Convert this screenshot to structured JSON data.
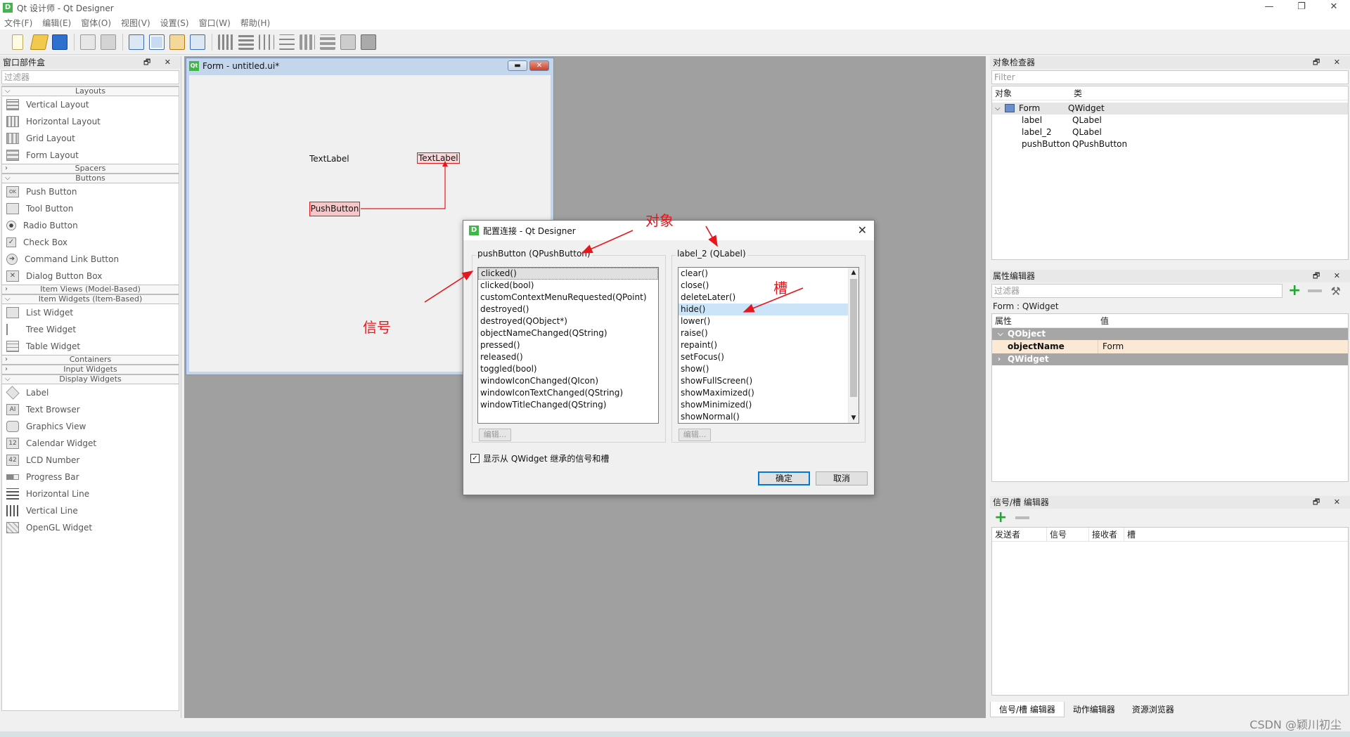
{
  "app": {
    "title": "Qt 设计师 - Qt Designer",
    "logo": "D",
    "window_controls": [
      "—",
      "❐",
      "✕"
    ]
  },
  "menu": [
    "文件(F)",
    "编辑(E)",
    "窗体(O)",
    "视图(V)",
    "设置(S)",
    "窗口(W)",
    "帮助(H)"
  ],
  "widget_box": {
    "title": "窗口部件盒",
    "filter_placeholder": "过滤器",
    "categories": {
      "layouts": "Layouts",
      "spacers": "Spacers",
      "buttons": "Buttons",
      "item_views": "Item Views (Model-Based)",
      "item_widgets": "Item Widgets (Item-Based)",
      "containers": "Containers",
      "input_widgets": "Input Widgets",
      "display_widgets": "Display Widgets"
    },
    "layout_items": [
      "Vertical Layout",
      "Horizontal Layout",
      "Grid Layout",
      "Form Layout"
    ],
    "button_items": [
      "Push Button",
      "Tool Button",
      "Radio Button",
      "Check Box",
      "Command Link Button",
      "Dialog Button Box"
    ],
    "item_widget_items": [
      "List Widget",
      "Tree Widget",
      "Table Widget"
    ],
    "display_items": [
      "Label",
      "Text Browser",
      "Graphics View",
      "Calendar Widget",
      "LCD Number",
      "Progress Bar",
      "Horizontal Line",
      "Vertical Line",
      "OpenGL Widget"
    ]
  },
  "form": {
    "title": "Form - untitled.ui*",
    "qt_badge": "Qt",
    "label1": "TextLabel",
    "label2": "TextLabel",
    "button": "PushButton"
  },
  "dialog": {
    "title": "配置连接 - Qt Designer",
    "close": "✕",
    "sender_title": "pushButton (QPushButton)",
    "receiver_title": "label_2 (QLabel)",
    "signals": [
      "clicked()",
      "clicked(bool)",
      "customContextMenuRequested(QPoint)",
      "destroyed()",
      "destroyed(QObject*)",
      "objectNameChanged(QString)",
      "pressed()",
      "released()",
      "toggled(bool)",
      "windowIconChanged(QIcon)",
      "windowIconTextChanged(QString)",
      "windowTitleChanged(QString)"
    ],
    "slots": [
      "clear()",
      "close()",
      "deleteLater()",
      "hide()",
      "lower()",
      "raise()",
      "repaint()",
      "setFocus()",
      "show()",
      "showFullScreen()",
      "showMaximized()",
      "showMinimized()",
      "showNormal()"
    ],
    "edit_label": "编辑...",
    "inherit_checkbox": "显示从 QWidget 继承的信号和槽",
    "ok": "确定",
    "cancel": "取消"
  },
  "annotations": {
    "object": "对象",
    "signal": "信号",
    "slot": "槽"
  },
  "object_inspector": {
    "title": "对象检查器",
    "filter_placeholder": "Filter",
    "col_object": "对象",
    "col_class": "类",
    "rows": [
      {
        "name": "Form",
        "cls": "QWidget"
      },
      {
        "name": "label",
        "cls": "QLabel"
      },
      {
        "name": "label_2",
        "cls": "QLabel"
      },
      {
        "name": "pushButton",
        "cls": "QPushButton"
      }
    ]
  },
  "property_editor": {
    "title": "属性编辑器",
    "filter_placeholder": "过滤器",
    "context": "Form : QWidget",
    "col_prop": "属性",
    "col_value": "值",
    "group1": "QObject",
    "prop_name": "objectName",
    "prop_value": "Form",
    "group2": "QWidget"
  },
  "signal_slot_editor": {
    "title": "信号/槽 编辑器",
    "cols": [
      "发送者",
      "信号",
      "接收者",
      "槽"
    ]
  },
  "bottom_tabs": [
    "信号/槽 编辑器",
    "动作编辑器",
    "资源浏览器"
  ],
  "watermark": "CSDN @颖川初尘",
  "dock_controls": "🗗 ✕",
  "colors": {
    "accent_red": "#e5161c",
    "selection_blue": "#cce4f7",
    "qt_green": "#41b44a"
  }
}
